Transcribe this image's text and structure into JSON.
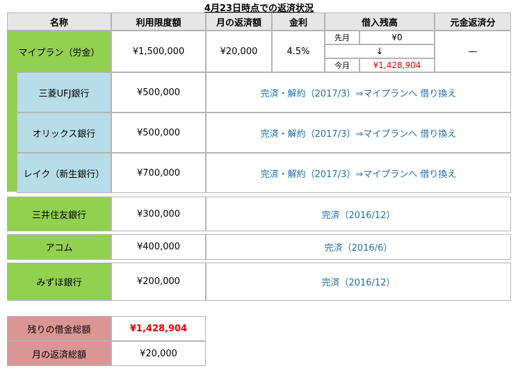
{
  "title": "4月23日時点での返済状況",
  "headers": {
    "name": "名称",
    "limit": "利用限度額",
    "monthly": "月の返済額",
    "rate": "金利",
    "balance": "借入残高",
    "principal": "元金返済分"
  },
  "main_row": {
    "name": "マイプラン（労金）",
    "limit": "¥1,500,000",
    "monthly": "¥20,000",
    "rate": "4.5%",
    "prev_label": "先月",
    "prev_value": "¥0",
    "arrow": "↓",
    "now_label": "今月",
    "now_value": "¥1,428,904",
    "principal": "—"
  },
  "sub_rows": [
    {
      "name": "三菱UFJ銀行",
      "limit": "¥500,000",
      "status": "完済・解約（2017/3）⇒マイプランへ 借り換え"
    },
    {
      "name": "オリックス銀行",
      "limit": "¥500,000",
      "status": "完済・解約（2017/3）⇒マイプランへ 借り換え"
    },
    {
      "name": "レイク（新生銀行）",
      "limit": "¥700,000",
      "status": "完済・解約（2017/3）⇒マイプランへ 借り換え"
    }
  ],
  "other_rows": [
    {
      "name": "三井住友銀行",
      "limit": "¥300,000",
      "status": "完済（2016/12）"
    },
    {
      "name": "アコム",
      "limit": "¥400,000",
      "status": "完済（2016/6）"
    },
    {
      "name": "みずほ銀行",
      "limit": "¥200,000",
      "status": "完済（2016/12）"
    }
  ],
  "summary": {
    "total_label": "残りの借金総額",
    "total_value": "¥1,428,904",
    "monthly_label": "月の返済総額",
    "monthly_value": "¥20,000"
  },
  "colors": {
    "green": "#92d050",
    "blue": "#b7dde8",
    "pink": "#da9694",
    "header": "#e6e6e6",
    "status_text": "#1f6fa8",
    "red": "#e60000"
  }
}
